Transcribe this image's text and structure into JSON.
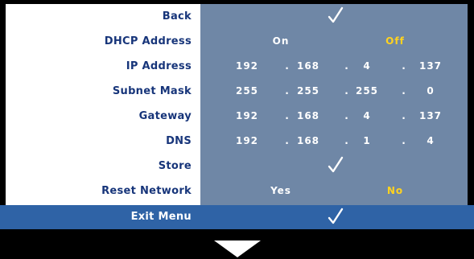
{
  "menu": {
    "rows": [
      {
        "label": "Back"
      },
      {
        "label": "DHCP Address",
        "options": [
          "On",
          "Off"
        ],
        "selected": "Off"
      },
      {
        "label": "IP Address",
        "octets": [
          "192",
          "168",
          "4",
          "137"
        ]
      },
      {
        "label": "Subnet Mask",
        "octets": [
          "255",
          "255",
          "255",
          "0"
        ]
      },
      {
        "label": "Gateway",
        "octets": [
          "192",
          "168",
          "4",
          "137"
        ]
      },
      {
        "label": "DNS",
        "octets": [
          "192",
          "168",
          "1",
          "4"
        ]
      },
      {
        "label": "Store"
      },
      {
        "label": "Reset Network",
        "options": [
          "Yes",
          "No"
        ],
        "selected": "No"
      }
    ],
    "exit": {
      "label": "Exit Menu"
    },
    "separator": ".",
    "icons": {
      "confirm": "checkmark-icon",
      "scroll": "down-arrow-icon"
    },
    "colors": {
      "label": "#17357a",
      "value_panel": "#6f87a6",
      "selected": "#ffd21f",
      "highlight": "#2f63a6"
    }
  }
}
